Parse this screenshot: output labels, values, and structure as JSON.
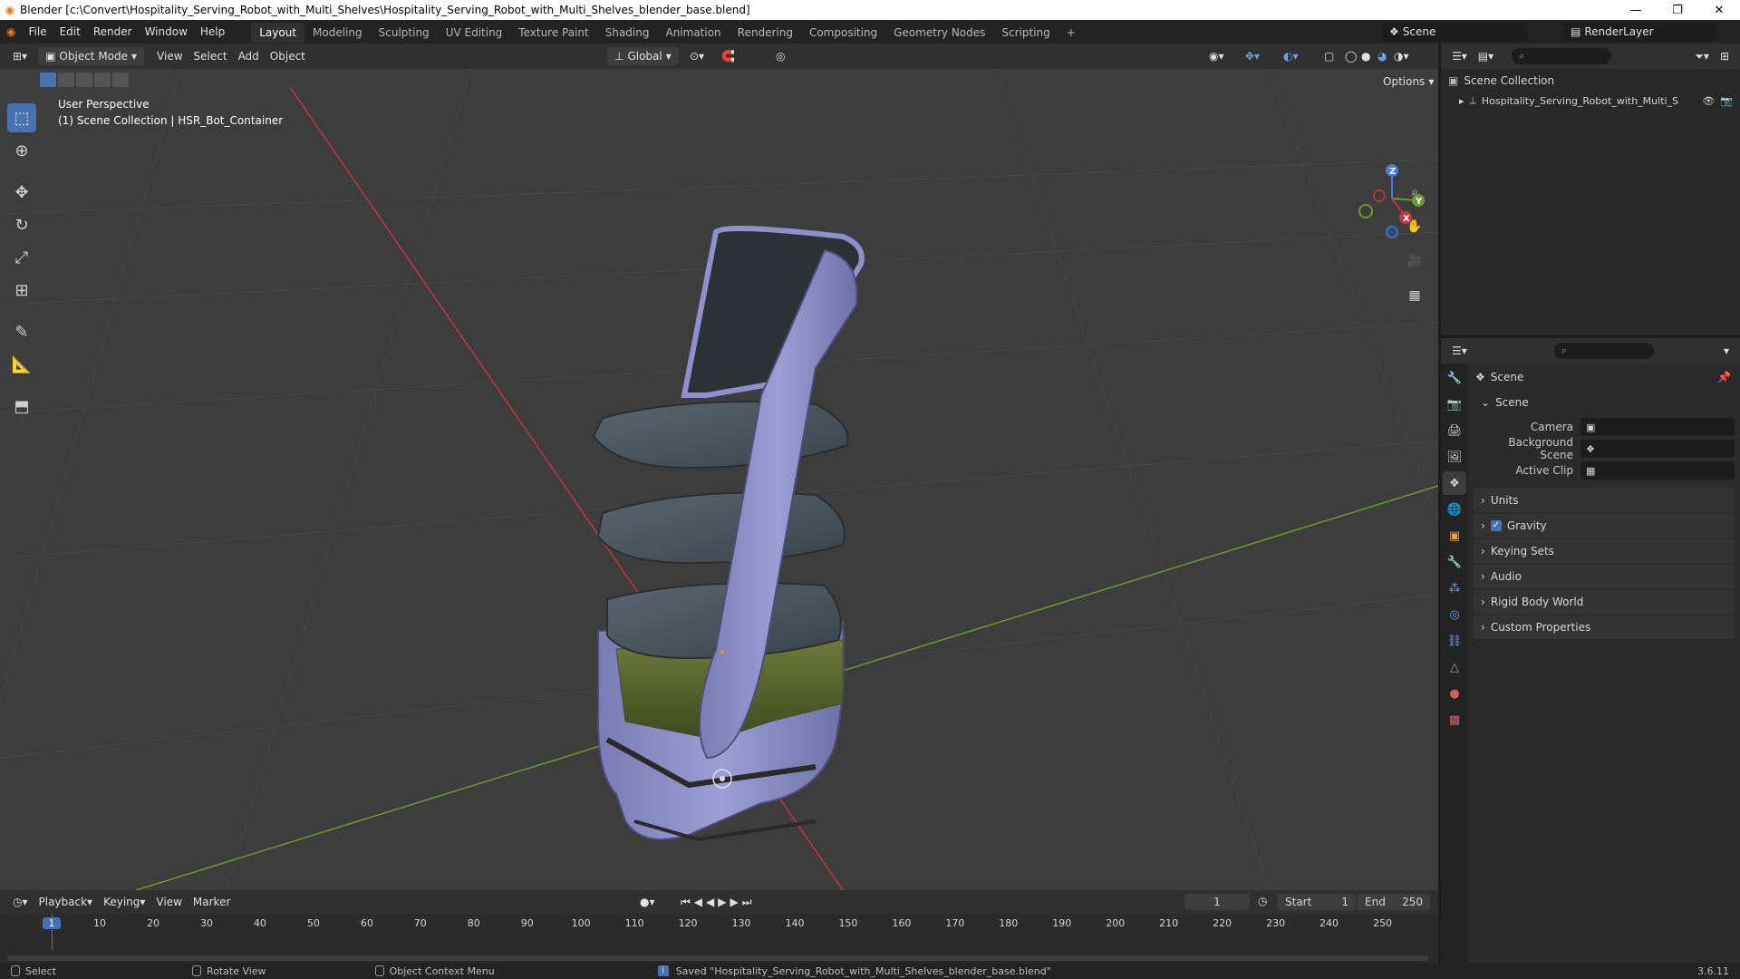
{
  "titlebar": {
    "title": "Blender [c:\\Convert\\Hospitality_Serving_Robot_with_Multi_Shelves\\Hospitality_Serving_Robot_with_Multi_Shelves_blender_base.blend]",
    "minimize": "—",
    "maximize": "❐",
    "close": "✕"
  },
  "menu": [
    "File",
    "Edit",
    "Render",
    "Window",
    "Help"
  ],
  "workspaces": [
    "Layout",
    "Modeling",
    "Sculpting",
    "UV Editing",
    "Texture Paint",
    "Shading",
    "Animation",
    "Rendering",
    "Compositing",
    "Geometry Nodes",
    "Scripting"
  ],
  "workspace_add": "+",
  "scene_selector": "Scene",
  "renderlayer_selector": "RenderLayer",
  "viewport_header": {
    "mode": "Object Mode",
    "menus": [
      "View",
      "Select",
      "Add",
      "Object"
    ],
    "transform_orientation": "Global",
    "options": "Options"
  },
  "viewport": {
    "perspective_label": "User Perspective",
    "collection_label": "(1) Scene Collection | HSR_Bot_Container",
    "gizmo_axes": [
      "X",
      "Y",
      "Z"
    ],
    "colors": {
      "x_axis": "#c6363f",
      "y_axis": "#6c9a2c",
      "robot_body": "#8e8fcc",
      "shelf": "#4a5560",
      "grid": "#4a4a4a"
    }
  },
  "outliner": {
    "root": "Scene Collection",
    "items": [
      {
        "label": "Hospitality_Serving_Robot_with_Multi_S"
      }
    ]
  },
  "properties": {
    "context_title": "Scene",
    "section_scene": "Scene",
    "fields": [
      {
        "label": "Camera",
        "value": ""
      },
      {
        "label": "Background Scene",
        "value": ""
      },
      {
        "label": "Active Clip",
        "value": ""
      }
    ],
    "panels": [
      "Units",
      "Gravity",
      "Keying Sets",
      "Audio",
      "Rigid Body World",
      "Custom Properties"
    ],
    "gravity_checked": true
  },
  "timeline": {
    "menus": [
      "Playback",
      "Keying",
      "View",
      "Marker"
    ],
    "current_frame": "1",
    "start_label": "Start",
    "start": "1",
    "end_label": "End",
    "end": "250",
    "ruler": [
      "1",
      "10",
      "20",
      "30",
      "40",
      "50",
      "60",
      "70",
      "80",
      "90",
      "100",
      "110",
      "120",
      "130",
      "140",
      "150",
      "160",
      "170",
      "180",
      "190",
      "200",
      "210",
      "220",
      "230",
      "240",
      "250"
    ]
  },
  "statusbar": {
    "select": "Select",
    "rotate": "Rotate View",
    "context_menu": "Object Context Menu",
    "message": "Saved \"Hospitality_Serving_Robot_with_Multi_Shelves_blender_base.blend\"",
    "version": "3.6.11"
  }
}
